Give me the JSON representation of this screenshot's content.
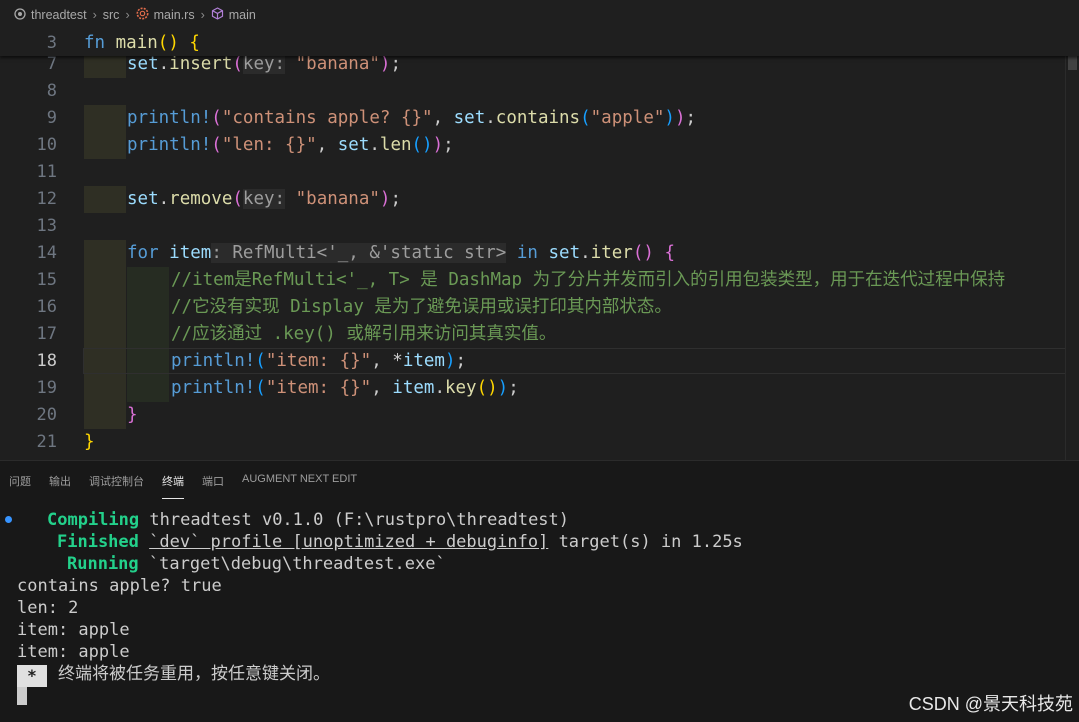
{
  "breadcrumb": {
    "folder": "threadtest",
    "src": "src",
    "file": "main.rs",
    "symbol": "main"
  },
  "editor": {
    "sticky": {
      "ln": "3",
      "kw": "fn",
      "name": "main",
      "rest": "()"
    },
    "lines": [
      {
        "ln": "7"
      },
      {
        "ln": "8"
      },
      {
        "ln": "9"
      },
      {
        "ln": "10"
      },
      {
        "ln": "11"
      },
      {
        "ln": "12"
      },
      {
        "ln": "13"
      },
      {
        "ln": "14"
      },
      {
        "ln": "15"
      },
      {
        "ln": "16"
      },
      {
        "ln": "17"
      },
      {
        "ln": "18"
      },
      {
        "ln": "19"
      },
      {
        "ln": "20"
      },
      {
        "ln": "21"
      }
    ],
    "tokens": {
      "set": "set",
      "insert": "insert",
      "key_hint": "key:",
      "banana": "\"banana\"",
      "println": "println!",
      "contains_fmt": "\"contains apple? {}\"",
      "contains": "contains",
      "apple": "\"apple\"",
      "len_fmt": "\"len: {}\"",
      "len": "len",
      "remove": "remove",
      "for": "for",
      "item": "item",
      "type_hint": ": RefMulti<'_, &'static str>",
      "in": "in",
      "iter": "iter",
      "comment1": "//item是RefMulti<'_, T> 是 DashMap 为了分片并发而引入的引用包装类型，用于在迭代过程中保持",
      "comment2": "//它没有实现 Display 是为了避免误用或误打印其内部状态。",
      "comment3": "//应该通过 .key() 或解引用来访问其真实值。",
      "item_fmt": "\"item: {}\"",
      "key": "key"
    }
  },
  "panel": {
    "tabs": [
      "问题",
      "输出",
      "调试控制台",
      "终端",
      "端口",
      "AUGMENT NEXT EDIT"
    ],
    "active_tab": "终端",
    "terminal": {
      "compiling_label": "Compiling",
      "compiling_text": "threadtest v0.1.0 (F:\\rustpro\\threadtest)",
      "finished_label": "Finished",
      "finished_profile": "`dev` profile [unoptimized + debuginfo]",
      "finished_rest": "target(s) in 1.25s",
      "running_label": "Running",
      "running_text": "`target\\debug\\threadtest.exe`",
      "out1": "contains apple? true",
      "out2": "len: 2",
      "out3": "item: apple",
      "out4": "item: apple",
      "reuse_star": "*",
      "reuse_msg": "终端将被任务重用，按任意键关闭。"
    }
  },
  "watermark": "CSDN @景天科技苑"
}
